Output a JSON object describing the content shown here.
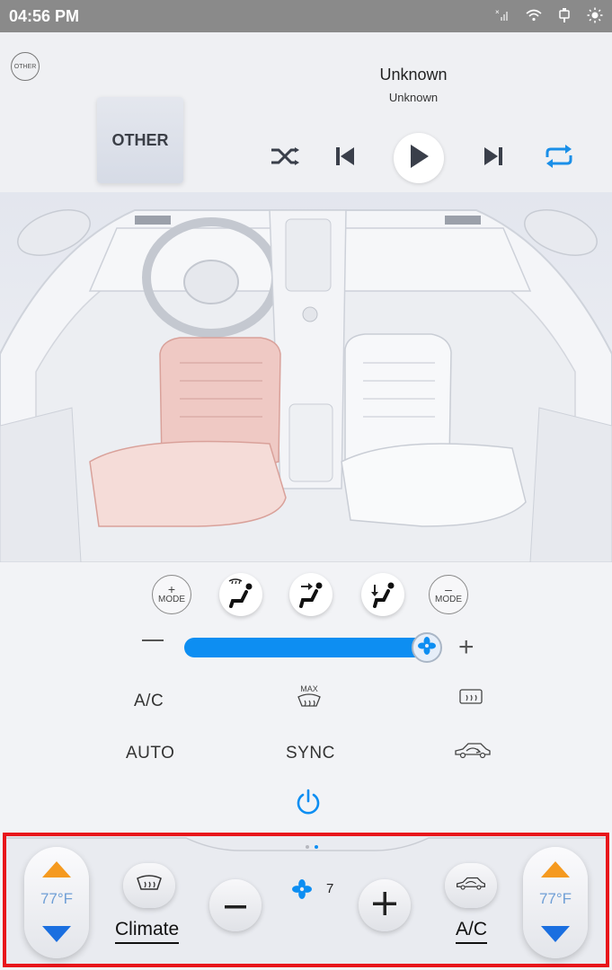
{
  "status_bar": {
    "time": "04:56 PM",
    "icons": [
      "signal-icon",
      "wifi-icon",
      "usb-icon",
      "brightness-icon"
    ]
  },
  "media": {
    "source_badge": "OTHER",
    "title": "Unknown",
    "subtitle": "Unknown",
    "album_art_label": "OTHER",
    "controls": [
      "shuffle-icon",
      "previous-icon",
      "play-icon",
      "next-icon",
      "repeat-icon"
    ],
    "repeat_active_color": "#1a8fe8"
  },
  "climate": {
    "mode_plus": {
      "sign": "+",
      "label": "MODE"
    },
    "mode_minus": {
      "sign": "–",
      "label": "MODE"
    },
    "vent_modes": [
      "windshield-defrost-feet-icon",
      "face-vent-icon",
      "feet-vent-icon"
    ],
    "fan_slider": {
      "min_label": "—",
      "max_label": "+",
      "level_fraction": 0.95
    },
    "buttons_row1": {
      "ac": "A/C",
      "max_defrost": "MAX",
      "rear_defrost": "rear-defrost-icon"
    },
    "buttons_row2": {
      "auto": "AUTO",
      "sync": "SYNC",
      "recirculation": "recirculation-car-icon"
    },
    "power": "power-icon",
    "accent_color": "#0d8ef2",
    "heated_seat_color": "#e9b3b0"
  },
  "dock": {
    "left_temp": "77°F",
    "right_temp": "77°F",
    "climate_label": "Climate",
    "ac_label": "A/C",
    "fan_level": "7",
    "page_dots": 2,
    "active_dot": 1
  }
}
